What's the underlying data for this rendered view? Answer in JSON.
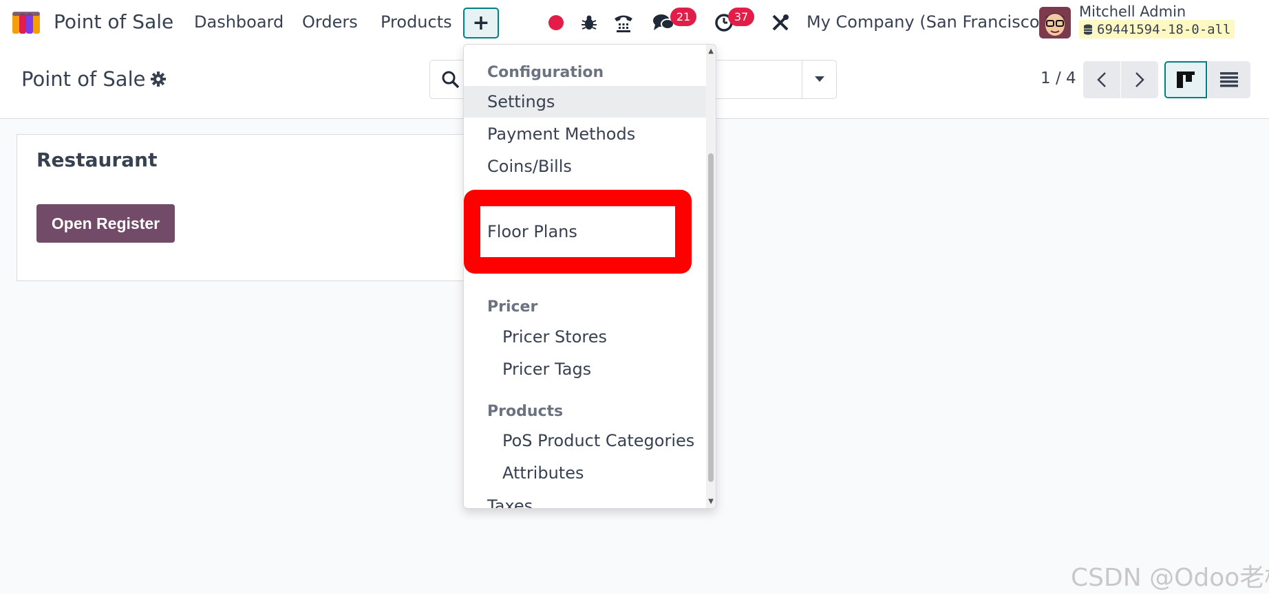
{
  "navbar": {
    "app_title": "Point of Sale",
    "menu": {
      "dashboard": "Dashboard",
      "orders": "Orders",
      "products": "Products",
      "config_symbol": "+"
    },
    "badges": {
      "chat": "21",
      "activity": "37"
    },
    "company": "My Company (San Francisco)",
    "user": {
      "name": "Mitchell Admin",
      "db": "69441594-18-0-all"
    },
    "icons": [
      "record-icon",
      "bug-icon",
      "phone-icon",
      "chat-icon",
      "clock-icon",
      "tools-icon"
    ]
  },
  "control_panel": {
    "breadcrumb": "Point of Sale",
    "pager": "1 / 4"
  },
  "card": {
    "title": "Restaurant",
    "button": "Open Register"
  },
  "dropdown": {
    "sections": [
      {
        "header": "Configuration",
        "items": [
          "Settings",
          "Payment Methods",
          "Coins/Bills",
          "Floor Plans"
        ]
      },
      {
        "header": "Pricer",
        "items": [
          "Pricer Stores",
          "Pricer Tags"
        ]
      },
      {
        "header": "Products",
        "items": [
          "PoS Product Categories",
          "Attributes"
        ]
      },
      {
        "header": "Taxes",
        "items": []
      }
    ],
    "selected": "Settings",
    "highlighted": "Floor Plans"
  },
  "watermark": "CSDN @Odoo老杨",
  "colors": {
    "accent": "#017e84",
    "brand": "#714b67",
    "badge": "#e11d48",
    "highlight": "#ff0000"
  }
}
